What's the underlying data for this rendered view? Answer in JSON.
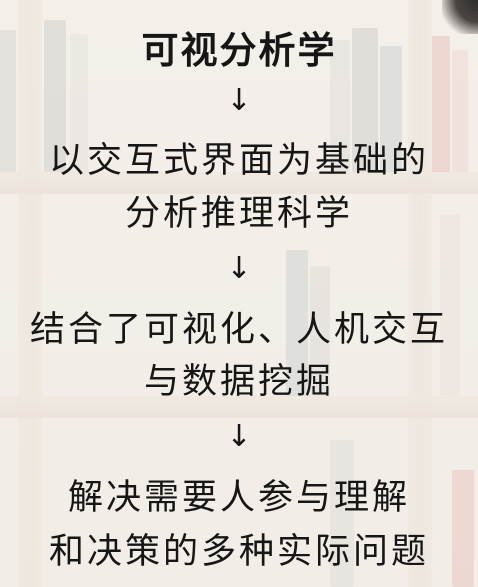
{
  "title": "可视分析学",
  "arrow": "↓",
  "steps": [
    {
      "lines": [
        "以交互式界面为基础的",
        "分析推理科学"
      ]
    },
    {
      "lines": [
        "结合了可视化、人机交互",
        "与数据挖掘"
      ]
    },
    {
      "lines": [
        "解决需要人参与理解",
        "和决策的多种实际问题"
      ]
    }
  ],
  "colors": {
    "text": "#161616",
    "background": "#e9e3dc"
  }
}
